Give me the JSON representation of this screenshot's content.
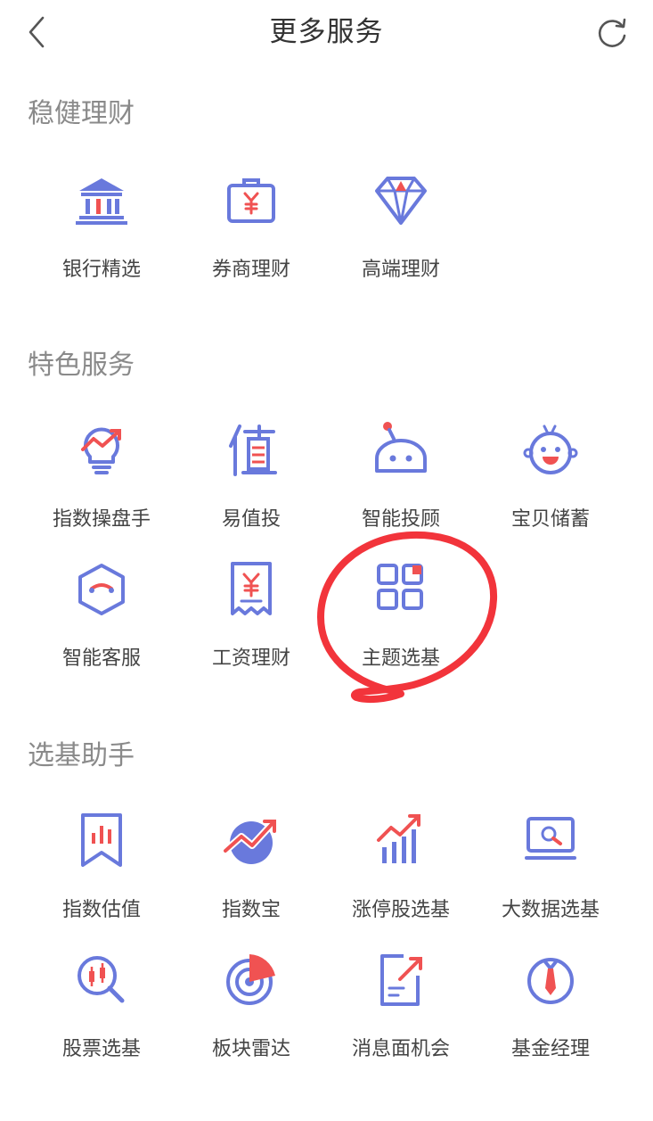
{
  "header": {
    "title": "更多服务",
    "back_icon": "chevron-left-icon",
    "refresh_icon": "refresh-icon"
  },
  "colors": {
    "accent_blue": "#6979dc",
    "accent_red": "#f05252",
    "section_gray": "#8a8a8a",
    "annotation_red": "#f2343b"
  },
  "sections": [
    {
      "title": "稳健理财",
      "items": [
        {
          "label": "银行精选",
          "icon": "bank-icon"
        },
        {
          "label": "券商理财",
          "icon": "briefcase-yen-icon"
        },
        {
          "label": "高端理财",
          "icon": "diamond-icon"
        }
      ]
    },
    {
      "title": "特色服务",
      "items": [
        {
          "label": "指数操盘手",
          "icon": "lightbulb-trend-icon"
        },
        {
          "label": "易值投",
          "icon": "value-char-icon"
        },
        {
          "label": "智能投顾",
          "icon": "robot-icon"
        },
        {
          "label": "宝贝储蓄",
          "icon": "baby-face-icon"
        },
        {
          "label": "智能客服",
          "icon": "hexagon-service-icon"
        },
        {
          "label": "工资理财",
          "icon": "receipt-yen-icon"
        },
        {
          "label": "主题选基",
          "icon": "grid-squares-icon"
        }
      ]
    },
    {
      "title": "选基助手",
      "items": [
        {
          "label": "指数估值",
          "icon": "bookmark-chart-icon"
        },
        {
          "label": "指数宝",
          "icon": "circle-trend-icon"
        },
        {
          "label": "涨停股选基",
          "icon": "bar-trend-icon"
        },
        {
          "label": "大数据选基",
          "icon": "monitor-search-icon"
        },
        {
          "label": "股票选基",
          "icon": "magnifier-candle-icon"
        },
        {
          "label": "板块雷达",
          "icon": "radar-icon"
        },
        {
          "label": "消息面机会",
          "icon": "document-arrow-icon"
        },
        {
          "label": "基金经理",
          "icon": "manager-tie-icon"
        }
      ]
    }
  ],
  "annotation": {
    "type": "circle",
    "target": "主题选基",
    "color": "#f2343b"
  }
}
